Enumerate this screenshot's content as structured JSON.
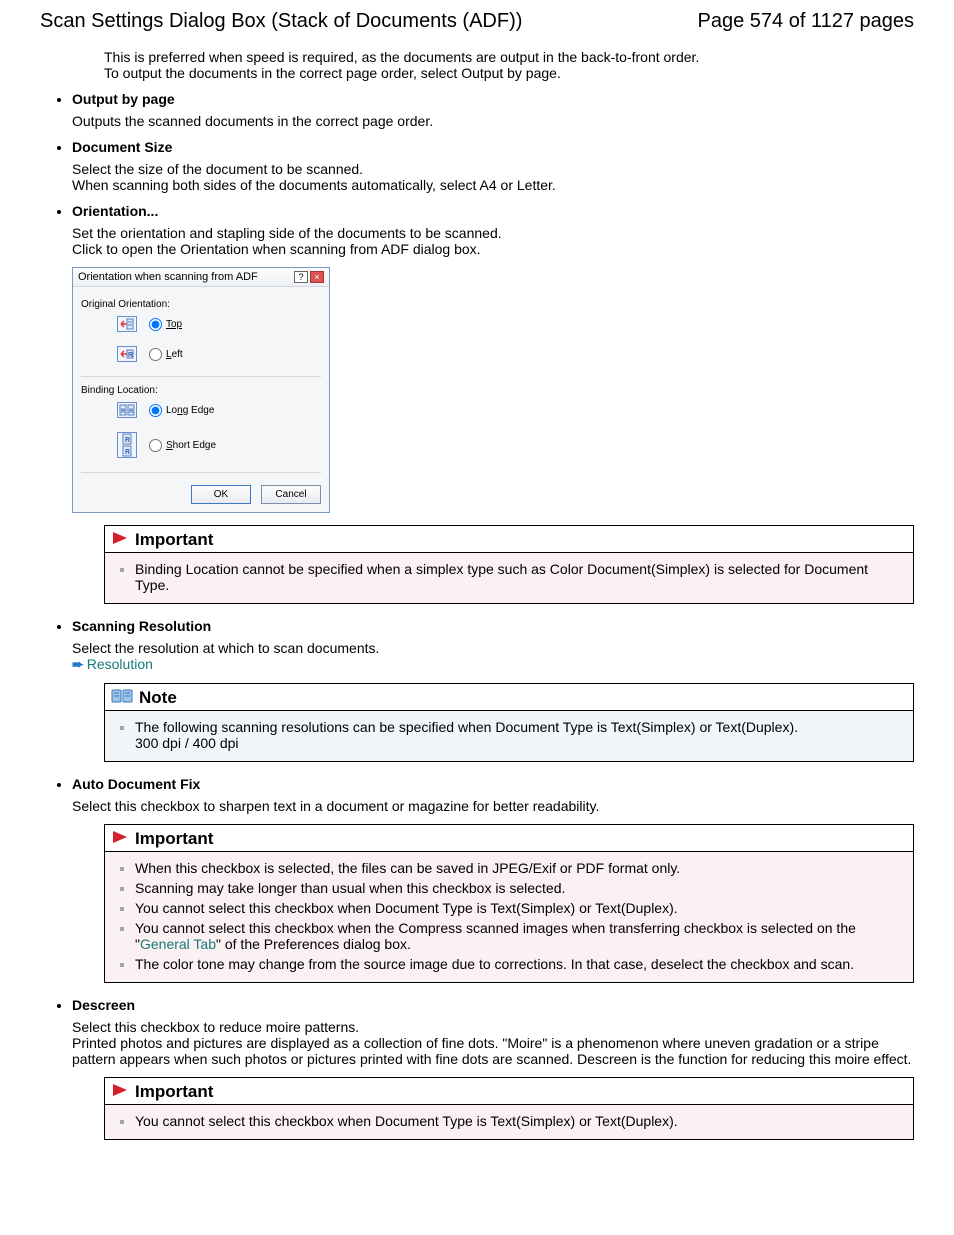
{
  "header": {
    "title": "Scan Settings Dialog Box (Stack of Documents (ADF))",
    "page": "Page 574 of 1127 pages"
  },
  "intro": {
    "l1": "This is preferred when speed is required, as the documents are output in the back-to-front order.",
    "l2": "To output the documents in the correct page order, select Output by page."
  },
  "output_by_page": {
    "label": "Output by page",
    "desc": "Outputs the scanned documents in the correct page order."
  },
  "document_size": {
    "label": "Document Size",
    "l1": "Select the size of the document to be scanned.",
    "l2": "When scanning both sides of the documents automatically, select A4 or Letter."
  },
  "orientation": {
    "label": "Orientation...",
    "l1": "Set the orientation and stapling side of the documents to be scanned.",
    "l2": "Click to open the Orientation when scanning from ADF dialog box."
  },
  "dialog": {
    "title": "Orientation when scanning from ADF",
    "original": "Original Orientation:",
    "top": "Top",
    "left": "Left",
    "binding": "Binding Location:",
    "long_edge": "Long Edge",
    "short_edge": "Short Edge",
    "ok": "OK",
    "cancel": "Cancel"
  },
  "important1": {
    "title": "Important",
    "item1": "Binding Location cannot be specified when a simplex type such as Color Document(Simplex) is selected for Document Type."
  },
  "scanning_resolution": {
    "label": "Scanning Resolution",
    "desc": "Select the resolution at which to scan documents.",
    "link": "Resolution"
  },
  "note1": {
    "title": "Note",
    "item1": "The following scanning resolutions can be specified when Document Type is Text(Simplex) or Text(Duplex).",
    "item1b": "300 dpi / 400 dpi"
  },
  "auto_doc_fix": {
    "label": "Auto Document Fix",
    "desc": "Select this checkbox to sharpen text in a document or magazine for better readability."
  },
  "important2": {
    "title": "Important",
    "i1": "When this checkbox is selected, the files can be saved in JPEG/Exif or PDF format only.",
    "i2": "Scanning may take longer than usual when this checkbox is selected.",
    "i3": "You cannot select this checkbox when Document Type is Text(Simplex) or Text(Duplex).",
    "i4a": "You cannot select this checkbox when the Compress scanned images when transferring checkbox is selected on the \"",
    "i4link": "General Tab",
    "i4b": "\" of the Preferences dialog box.",
    "i5": "The color tone may change from the source image due to corrections. In that case, deselect the checkbox and scan."
  },
  "descreen": {
    "label": "Descreen",
    "l1": "Select this checkbox to reduce moire patterns.",
    "l2": "Printed photos and pictures are displayed as a collection of fine dots. \"Moire\" is a phenomenon where uneven gradation or a stripe pattern appears when such photos or pictures printed with fine dots are scanned. Descreen is the function for reducing this moire effect."
  },
  "important3": {
    "title": "Important",
    "i1": "You cannot select this checkbox when Document Type is Text(Simplex) or Text(Duplex)."
  }
}
